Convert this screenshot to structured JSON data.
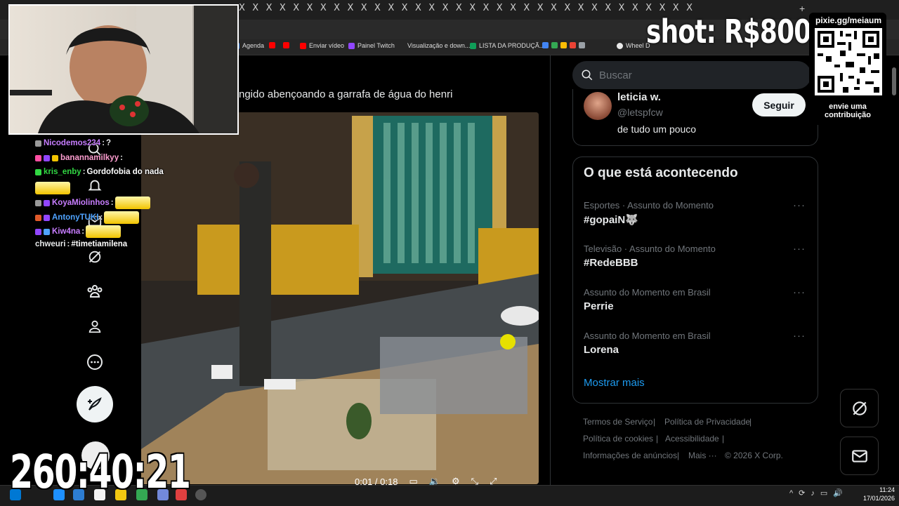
{
  "browser": {
    "tab_close_glyph": "X",
    "new_tab_glyph": "+",
    "bookmarks": [
      {
        "label": "Agenda",
        "color": "#4285f4"
      },
      {
        "label": "",
        "color": "#ff0000"
      },
      {
        "label": "Enviar vídeo",
        "color": "#ff0000"
      },
      {
        "label": "Painel Twitch",
        "color": "#9146ff"
      },
      {
        "label": "Visualização e down...",
        "color": "#666666"
      },
      {
        "label": "LISTA DA PRODUÇÃ...",
        "color": "#0f9d58"
      },
      {
        "label": "Wheel D",
        "color": "#e9e9e9"
      }
    ]
  },
  "sidebar": {
    "nav_icons": [
      "search-icon",
      "notifications-icon",
      "messages-icon",
      "grok-icon",
      "communities-icon",
      "profile-icon",
      "more-icon"
    ],
    "post_button_icon": "compose-icon"
  },
  "post": {
    "text": "ngido abençoando a garrafa de água do henri",
    "video": {
      "time": "0:01 / 0:18",
      "controls": [
        "captions-icon",
        "volume-icon",
        "settings-icon",
        "pip-icon",
        "fullscreen-icon"
      ]
    }
  },
  "search": {
    "placeholder": "Buscar"
  },
  "who_to_follow": {
    "name": "leticia w.",
    "handle": "@letspfcw",
    "bio": "de tudo um pouco",
    "follow_label": "Seguir"
  },
  "trends": {
    "title": "O que está acontecendo",
    "items": [
      {
        "context": "Esportes · Assunto do Momento",
        "name": "#gopaiN🐺"
      },
      {
        "context": "Televisão · Assunto do Momento",
        "name": "#RedeBBB"
      },
      {
        "context": "Assunto do Momento em Brasil",
        "name": "Perrie"
      },
      {
        "context": "Assunto do Momento em Brasil",
        "name": "Lorena"
      }
    ],
    "more_glyph": "···",
    "show_more": "Mostrar mais"
  },
  "footer": {
    "links": [
      "Termos de Serviço",
      "Política de Privacidade",
      "Política de cookies",
      "Acessibilidade",
      "Informações de anúncios",
      "Mais ···"
    ],
    "copyright": "© 2026 X Corp.",
    "separator": "|"
  },
  "taskbar": {
    "time": "11:24",
    "date": "17/01/2026"
  },
  "stream_overlay": {
    "shot_text": "shot: R$800",
    "pixie_url": "pixie.gg/meiaum",
    "pixie_cta": "envie uma contribuição",
    "timer": "260:40:21",
    "chat": [
      {
        "user": "Nicodemos234",
        "sep": ":",
        "msg": "?",
        "color": "#c77dff"
      },
      {
        "user": "banannamilkyy",
        "sep": ":",
        "msg": "",
        "color": "#ff9ed1"
      },
      {
        "user": "kris_enby",
        "sep": ":",
        "msg": "Gordofobia do nada",
        "color": "#31d843"
      },
      {
        "user": "KoyaMiolinhos",
        "sep": ":",
        "msg": "",
        "color": "#c77dff"
      },
      {
        "user": "AntonyTUKI",
        "sep": ":",
        "msg": "",
        "color": "#4fa3ff"
      },
      {
        "user": "Kiw4na",
        "sep": ":",
        "msg": "",
        "color": "#c77dff"
      },
      {
        "user": "chweuri",
        "sep": ":",
        "msg": "#timetiamilena",
        "color": "#e7e9ea"
      }
    ]
  }
}
